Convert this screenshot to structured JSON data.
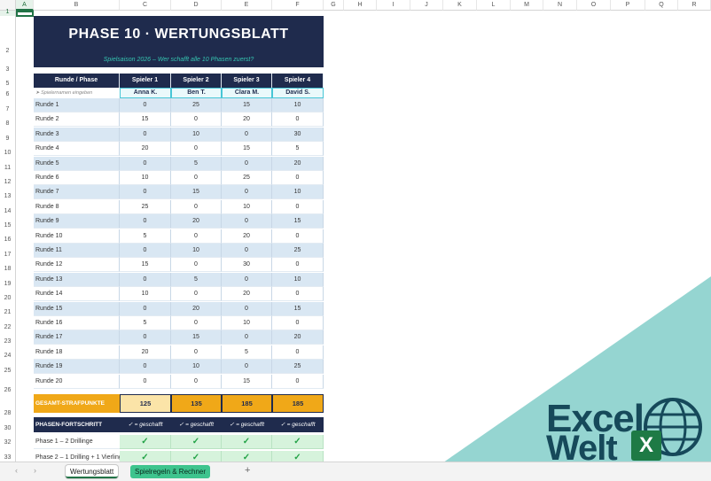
{
  "columns": [
    "A",
    "B",
    "C",
    "D",
    "E",
    "F",
    "G",
    "H",
    "I",
    "J",
    "K",
    "L",
    "M",
    "N",
    "O",
    "P",
    "Q",
    "R"
  ],
  "rows": [
    "1",
    "2",
    "3",
    "5",
    "6",
    "7",
    "8",
    "9",
    "10",
    "11",
    "12",
    "13",
    "14",
    "15",
    "16",
    "17",
    "18",
    "19",
    "20",
    "21",
    "22",
    "23",
    "24",
    "25",
    "26",
    "28",
    "30",
    "32",
    "33"
  ],
  "sheet": {
    "title": "PHASE 10 · WERTUNGSBLATT",
    "subtitle": "Spielsaison 2026 – Wer schafft alle 10 Phasen zuerst?",
    "header": [
      "Runde / Phase",
      "Spieler 1",
      "Spieler 2",
      "Spieler 3",
      "Spieler 4"
    ],
    "names_hint": "➤ Spielernamen eingeben",
    "names": [
      "Anna K.",
      "Ben T.",
      "Clara M.",
      "David S."
    ],
    "rounds": [
      {
        "label": "Runde 1",
        "v": [
          "0",
          "25",
          "15",
          "10"
        ]
      },
      {
        "label": "Runde 2",
        "v": [
          "15",
          "0",
          "20",
          "0"
        ]
      },
      {
        "label": "Runde 3",
        "v": [
          "0",
          "10",
          "0",
          "30"
        ]
      },
      {
        "label": "Runde 4",
        "v": [
          "20",
          "0",
          "15",
          "5"
        ]
      },
      {
        "label": "Runde 5",
        "v": [
          "0",
          "5",
          "0",
          "20"
        ]
      },
      {
        "label": "Runde 6",
        "v": [
          "10",
          "0",
          "25",
          "0"
        ]
      },
      {
        "label": "Runde 7",
        "v": [
          "0",
          "15",
          "0",
          "10"
        ]
      },
      {
        "label": "Runde 8",
        "v": [
          "25",
          "0",
          "10",
          "0"
        ]
      },
      {
        "label": "Runde 9",
        "v": [
          "0",
          "20",
          "0",
          "15"
        ]
      },
      {
        "label": "Runde 10",
        "v": [
          "5",
          "0",
          "20",
          "0"
        ]
      },
      {
        "label": "Runde 11",
        "v": [
          "0",
          "10",
          "0",
          "25"
        ]
      },
      {
        "label": "Runde 12",
        "v": [
          "15",
          "0",
          "30",
          "0"
        ]
      },
      {
        "label": "Runde 13",
        "v": [
          "0",
          "5",
          "0",
          "10"
        ]
      },
      {
        "label": "Runde 14",
        "v": [
          "10",
          "0",
          "20",
          "0"
        ]
      },
      {
        "label": "Runde 15",
        "v": [
          "0",
          "20",
          "0",
          "15"
        ]
      },
      {
        "label": "Runde 16",
        "v": [
          "5",
          "0",
          "10",
          "0"
        ]
      },
      {
        "label": "Runde 17",
        "v": [
          "0",
          "15",
          "0",
          "20"
        ]
      },
      {
        "label": "Runde 18",
        "v": [
          "20",
          "0",
          "5",
          "0"
        ]
      },
      {
        "label": "Runde 19",
        "v": [
          "0",
          "10",
          "0",
          "25"
        ]
      },
      {
        "label": "Runde 20",
        "v": [
          "0",
          "0",
          "15",
          "0"
        ]
      }
    ],
    "total_label": "GESAMT-STRAFPUNKTE",
    "totals": [
      "125",
      "135",
      "185",
      "185"
    ],
    "phase_header": "PHASEN-FORTSCHRITT",
    "phase_legend": "✓ = geschafft",
    "phases": [
      {
        "label": "Phase 1 – 2 Drillinge",
        "checks": [
          "✓",
          "✓",
          "✓",
          "✓"
        ]
      },
      {
        "label": "Phase 2 – 1 Drilling + 1 Vierling",
        "checks": [
          "✓",
          "✓",
          "✓",
          "✓"
        ]
      }
    ]
  },
  "tabs": {
    "active": "Wertungsblatt",
    "other": "Spielregeln & Rechner",
    "add": "+",
    "prev": "‹",
    "next": "›"
  },
  "watermark": {
    "line1": "Excel",
    "line2": "Welt",
    "badge": "X"
  },
  "colors": {
    "navy": "#1f2b4d",
    "teal": "#35c4b0",
    "orange": "#f0a818",
    "light_blue": "#d9e7f3",
    "check_green": "#23a347"
  }
}
